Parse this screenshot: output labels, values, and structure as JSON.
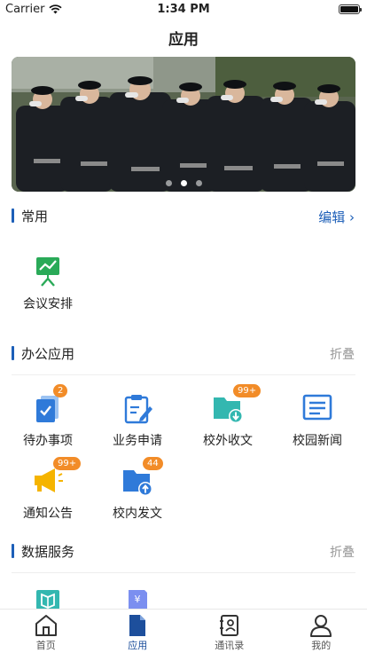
{
  "status_bar": {
    "carrier": "Carrier",
    "time": "1:34 PM",
    "battery_level": 1.0
  },
  "nav": {
    "title": "应用"
  },
  "banner": {
    "dots": 3,
    "active_dot": 1
  },
  "common": {
    "title": "常用",
    "action": "编辑 ›",
    "items": [
      {
        "label": "会议安排",
        "icon": "meeting-board-icon"
      }
    ]
  },
  "office": {
    "title": "办公应用",
    "action": "折叠",
    "items": [
      {
        "label": "待办事项",
        "icon": "todo-icon",
        "badge": "2"
      },
      {
        "label": "业务申请",
        "icon": "clipboard-edit-icon",
        "badge": ""
      },
      {
        "label": "校外收文",
        "icon": "folder-download-icon",
        "badge": "99+"
      },
      {
        "label": "校园新闻",
        "icon": "news-icon",
        "badge": ""
      },
      {
        "label": "通知公告",
        "icon": "megaphone-icon",
        "badge": "99+"
      },
      {
        "label": "校内发文",
        "icon": "folder-upload-icon",
        "badge": "44"
      }
    ]
  },
  "data_service": {
    "title": "数据服务",
    "action": "折叠",
    "items": [
      {
        "icon": "book-icon"
      },
      {
        "icon": "yuan-document-icon"
      }
    ]
  },
  "tabbar": {
    "tabs": [
      {
        "label": "首页",
        "icon": "home-icon"
      },
      {
        "label": "应用",
        "icon": "apps-icon"
      },
      {
        "label": "通讯录",
        "icon": "contacts-icon"
      },
      {
        "label": "我的",
        "icon": "profile-icon"
      }
    ],
    "active": 1
  },
  "colors": {
    "accent": "#1d5fb8",
    "badge": "#f28c28",
    "tab_active": "#1d4f9c"
  }
}
